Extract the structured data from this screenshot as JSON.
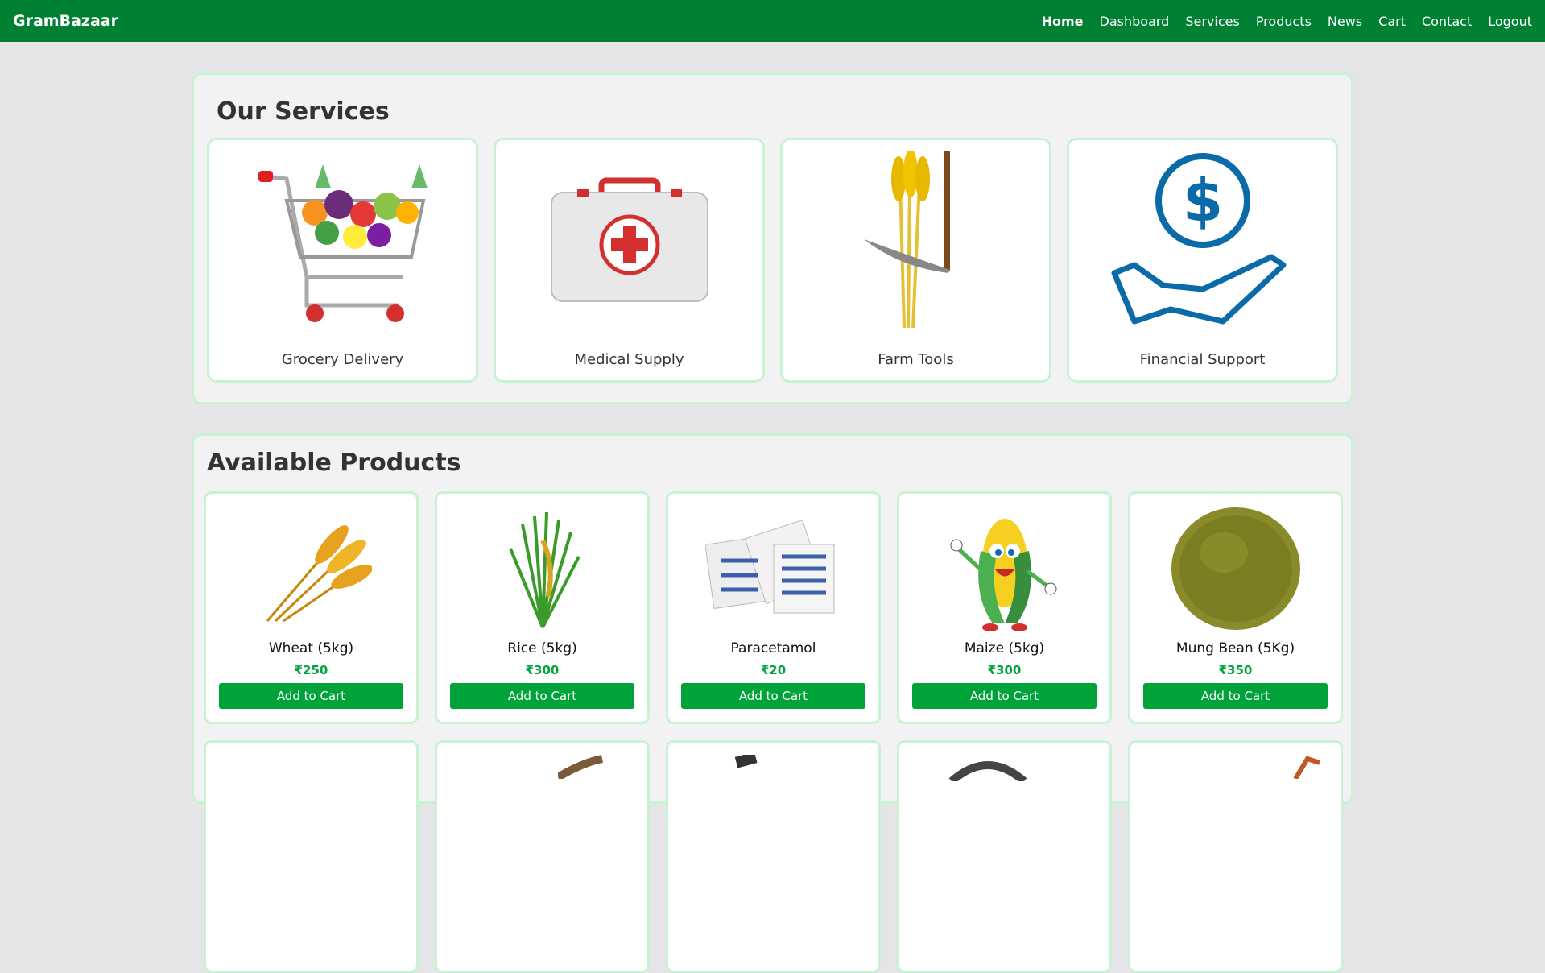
{
  "navbar": {
    "brand": "GramBazaar",
    "links": [
      "Home",
      "Dashboard",
      "Services",
      "Products",
      "News",
      "Cart",
      "Contact",
      "Logout"
    ],
    "active": "Home"
  },
  "services": {
    "title": "Our Services",
    "items": [
      {
        "label": "Grocery Delivery",
        "icon": "shopping-cart-icon"
      },
      {
        "label": "Medical Supply",
        "icon": "first-aid-kit-icon"
      },
      {
        "label": "Farm Tools",
        "icon": "wheat-sickle-icon"
      },
      {
        "label": "Financial Support",
        "icon": "dollar-hand-icon"
      }
    ]
  },
  "products": {
    "title": "Available Products",
    "add_label": "Add to Cart",
    "items": [
      {
        "name": "Wheat (5kg)",
        "price": "₹250"
      },
      {
        "name": "Rice (5kg)",
        "price": "₹300"
      },
      {
        "name": "Paracetamol",
        "price": "₹20"
      },
      {
        "name": "Maize (5kg)",
        "price": "₹300"
      },
      {
        "name": "Mung Bean (5Kg)",
        "price": "₹350"
      }
    ]
  },
  "colors": {
    "primary": "#008033",
    "button": "#00a33a",
    "card_border": "#c8f2d4"
  }
}
